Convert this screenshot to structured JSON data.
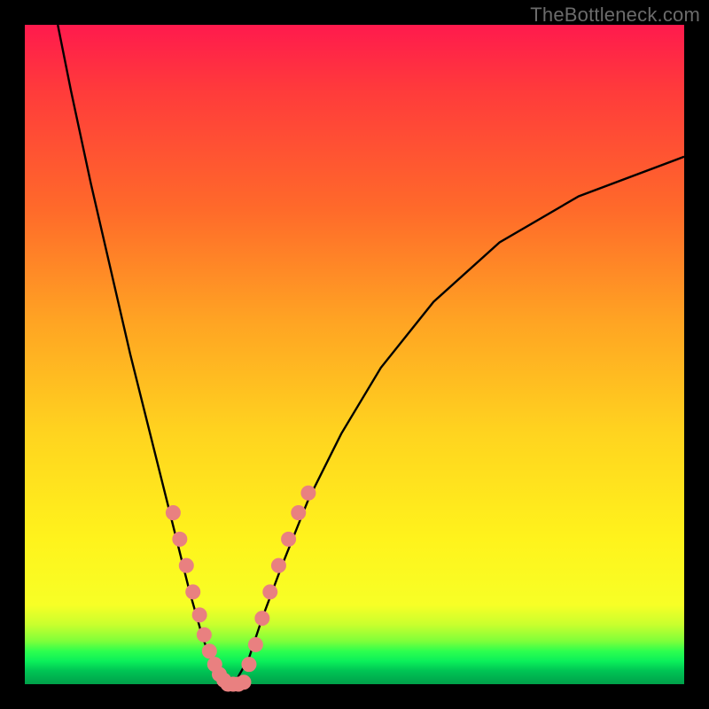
{
  "watermark": "TheBottleneck.com",
  "chart_data": {
    "type": "line",
    "title": "",
    "xlabel": "",
    "ylabel": "",
    "xlim": [
      0,
      100
    ],
    "ylim": [
      0,
      100
    ],
    "grid": false,
    "legend": false,
    "series": [
      {
        "name": "curve-left",
        "x": [
          5,
          7,
          10,
          13,
          16,
          19,
          21,
          23,
          25,
          27,
          28.5,
          30,
          31
        ],
        "y": [
          100,
          90,
          76,
          63,
          50,
          38,
          30,
          22,
          14,
          7,
          3,
          0.5,
          0
        ]
      },
      {
        "name": "curve-right",
        "x": [
          31,
          32,
          34,
          36,
          39,
          43,
          48,
          54,
          62,
          72,
          84,
          100
        ],
        "y": [
          0,
          0.5,
          4,
          10,
          18,
          28,
          38,
          48,
          58,
          67,
          74,
          80
        ]
      }
    ],
    "marker_groups": [
      {
        "name": "markers-left",
        "points": [
          {
            "x": 22.5,
            "y": 26
          },
          {
            "x": 23.5,
            "y": 22
          },
          {
            "x": 24.5,
            "y": 18
          },
          {
            "x": 25.5,
            "y": 14
          },
          {
            "x": 26.5,
            "y": 10.5
          },
          {
            "x": 27.2,
            "y": 7.5
          },
          {
            "x": 28.0,
            "y": 5
          },
          {
            "x": 28.8,
            "y": 3
          },
          {
            "x": 29.5,
            "y": 1.5
          },
          {
            "x": 30.2,
            "y": 0.6
          }
        ]
      },
      {
        "name": "markers-bottom",
        "points": [
          {
            "x": 30.8,
            "y": 0
          },
          {
            "x": 31.6,
            "y": 0
          },
          {
            "x": 32.4,
            "y": 0
          },
          {
            "x": 33.2,
            "y": 0.3
          }
        ]
      },
      {
        "name": "markers-right",
        "points": [
          {
            "x": 34.0,
            "y": 3
          },
          {
            "x": 35.0,
            "y": 6
          },
          {
            "x": 36.0,
            "y": 10
          },
          {
            "x": 37.2,
            "y": 14
          },
          {
            "x": 38.5,
            "y": 18
          },
          {
            "x": 40.0,
            "y": 22
          },
          {
            "x": 41.5,
            "y": 26
          },
          {
            "x": 43.0,
            "y": 29
          }
        ]
      }
    ]
  }
}
